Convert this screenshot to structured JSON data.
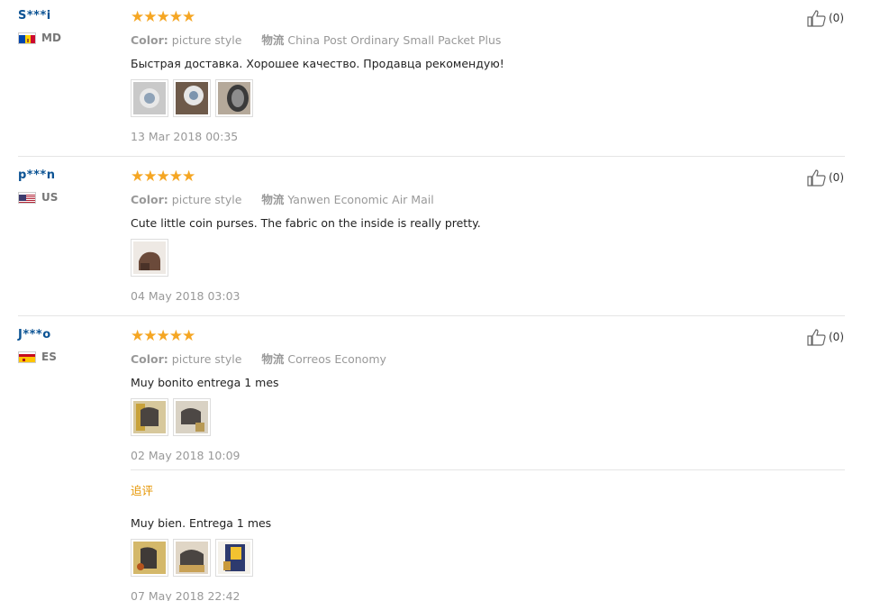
{
  "labels": {
    "color_key": "Color:",
    "shipping_key": "物流"
  },
  "reviews": [
    {
      "user": "S***i",
      "country": "MD",
      "stars": "★★★★★",
      "color": "picture style",
      "shipping": "China Post Ordinary Small Packet Plus",
      "text": "Быстрая доставка. Хорошее качество. Продавца рекомендую!",
      "date": "13 Mar 2018 00:35",
      "likes": "(0)",
      "photos": 3
    },
    {
      "user": "p***n",
      "country": "US",
      "stars": "★★★★★",
      "color": "picture style",
      "shipping": "Yanwen Economic Air Mail",
      "text": "Cute little coin purses. The fabric on the inside is really pretty.",
      "date": "04 May 2018 03:03",
      "likes": "(0)",
      "photos": 1
    },
    {
      "user": "J***o",
      "country": "ES",
      "stars": "★★★★★",
      "color": "picture style",
      "shipping": "Correos Economy",
      "text": "Muy bonito entrega 1 mes",
      "date": "02 May 2018 10:09",
      "likes": "(0)",
      "photos": 2,
      "followup": {
        "label": "追评",
        "text": "Muy bien. Entrega 1 mes",
        "date": "07 May 2018 22:42",
        "photos": 3
      }
    }
  ]
}
